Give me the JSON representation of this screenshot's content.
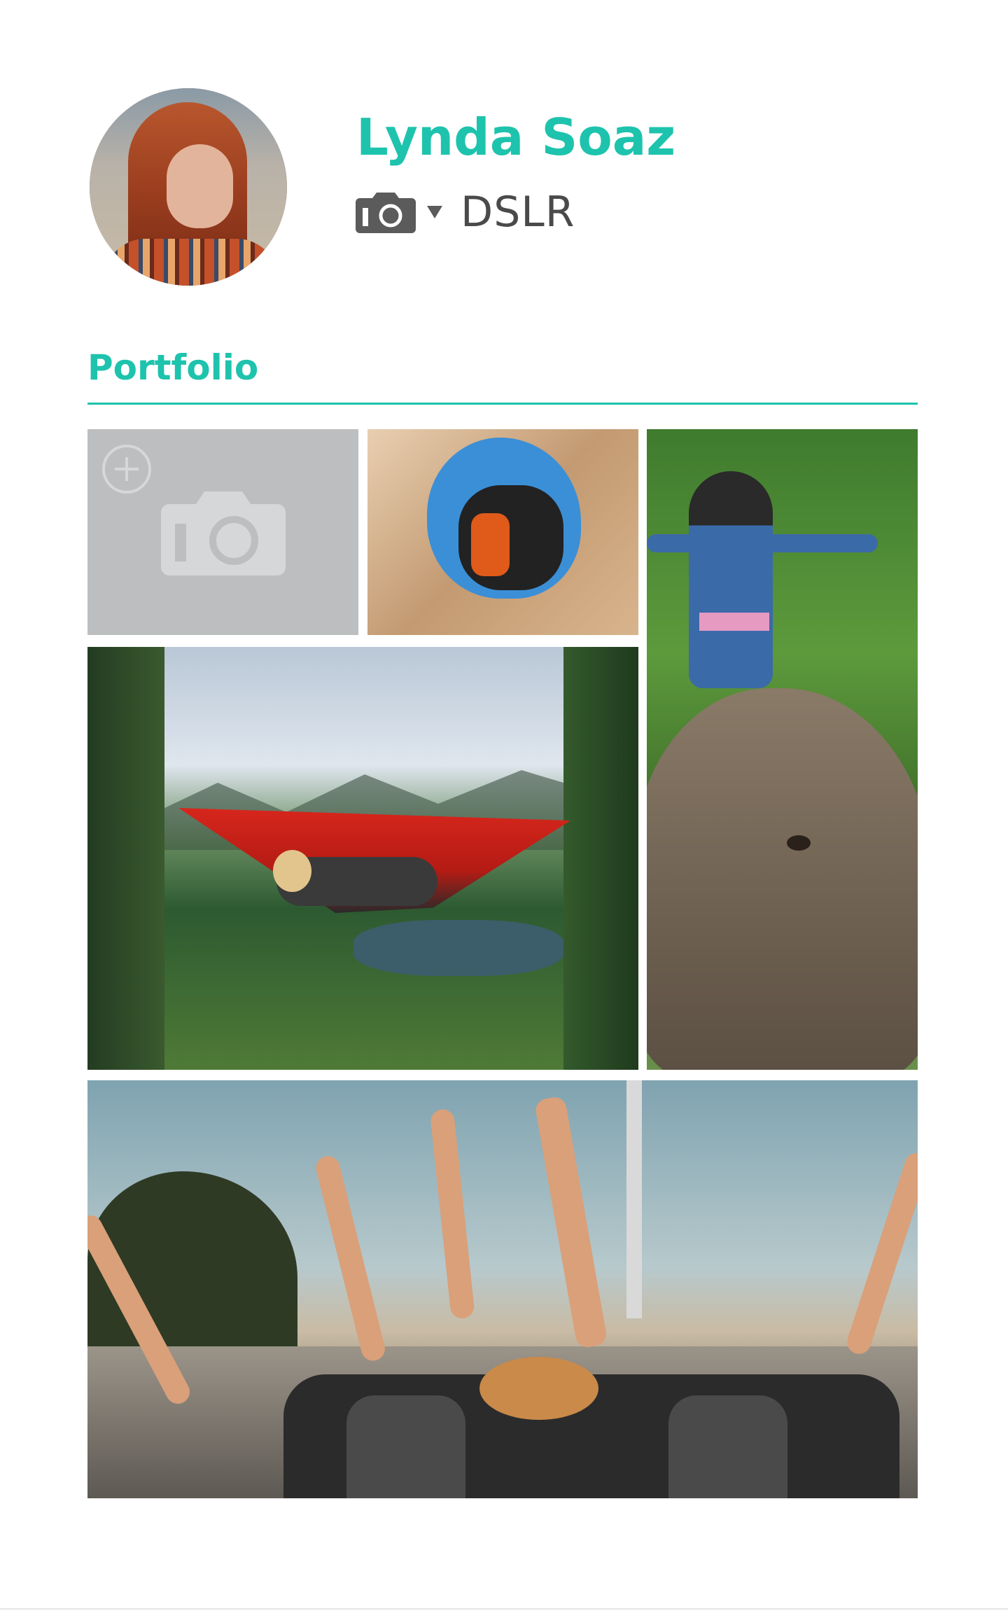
{
  "profile": {
    "name": "Lynda Soaz",
    "gear_label": "DSLR",
    "avatar_icon": "avatar",
    "gear_icon": "camera-icon",
    "gear_dropdown_icon": "triangle-down-icon"
  },
  "portfolio": {
    "title": "Portfolio",
    "add_tile_icons": [
      "plus-circle-icon",
      "camera-icon"
    ],
    "photos": [
      {
        "subject": "person in wooden tunnel sculpture"
      },
      {
        "subject": "woman riding elephant"
      },
      {
        "subject": "woman in red hammock by lake"
      },
      {
        "subject": "friends in convertible with raised hands"
      }
    ]
  },
  "colors": {
    "accent": "#1ec3ad",
    "gear_text": "#4a4a4a",
    "add_tile_bg": "#bcbec0",
    "add_tile_icon": "#d6d7d8"
  }
}
